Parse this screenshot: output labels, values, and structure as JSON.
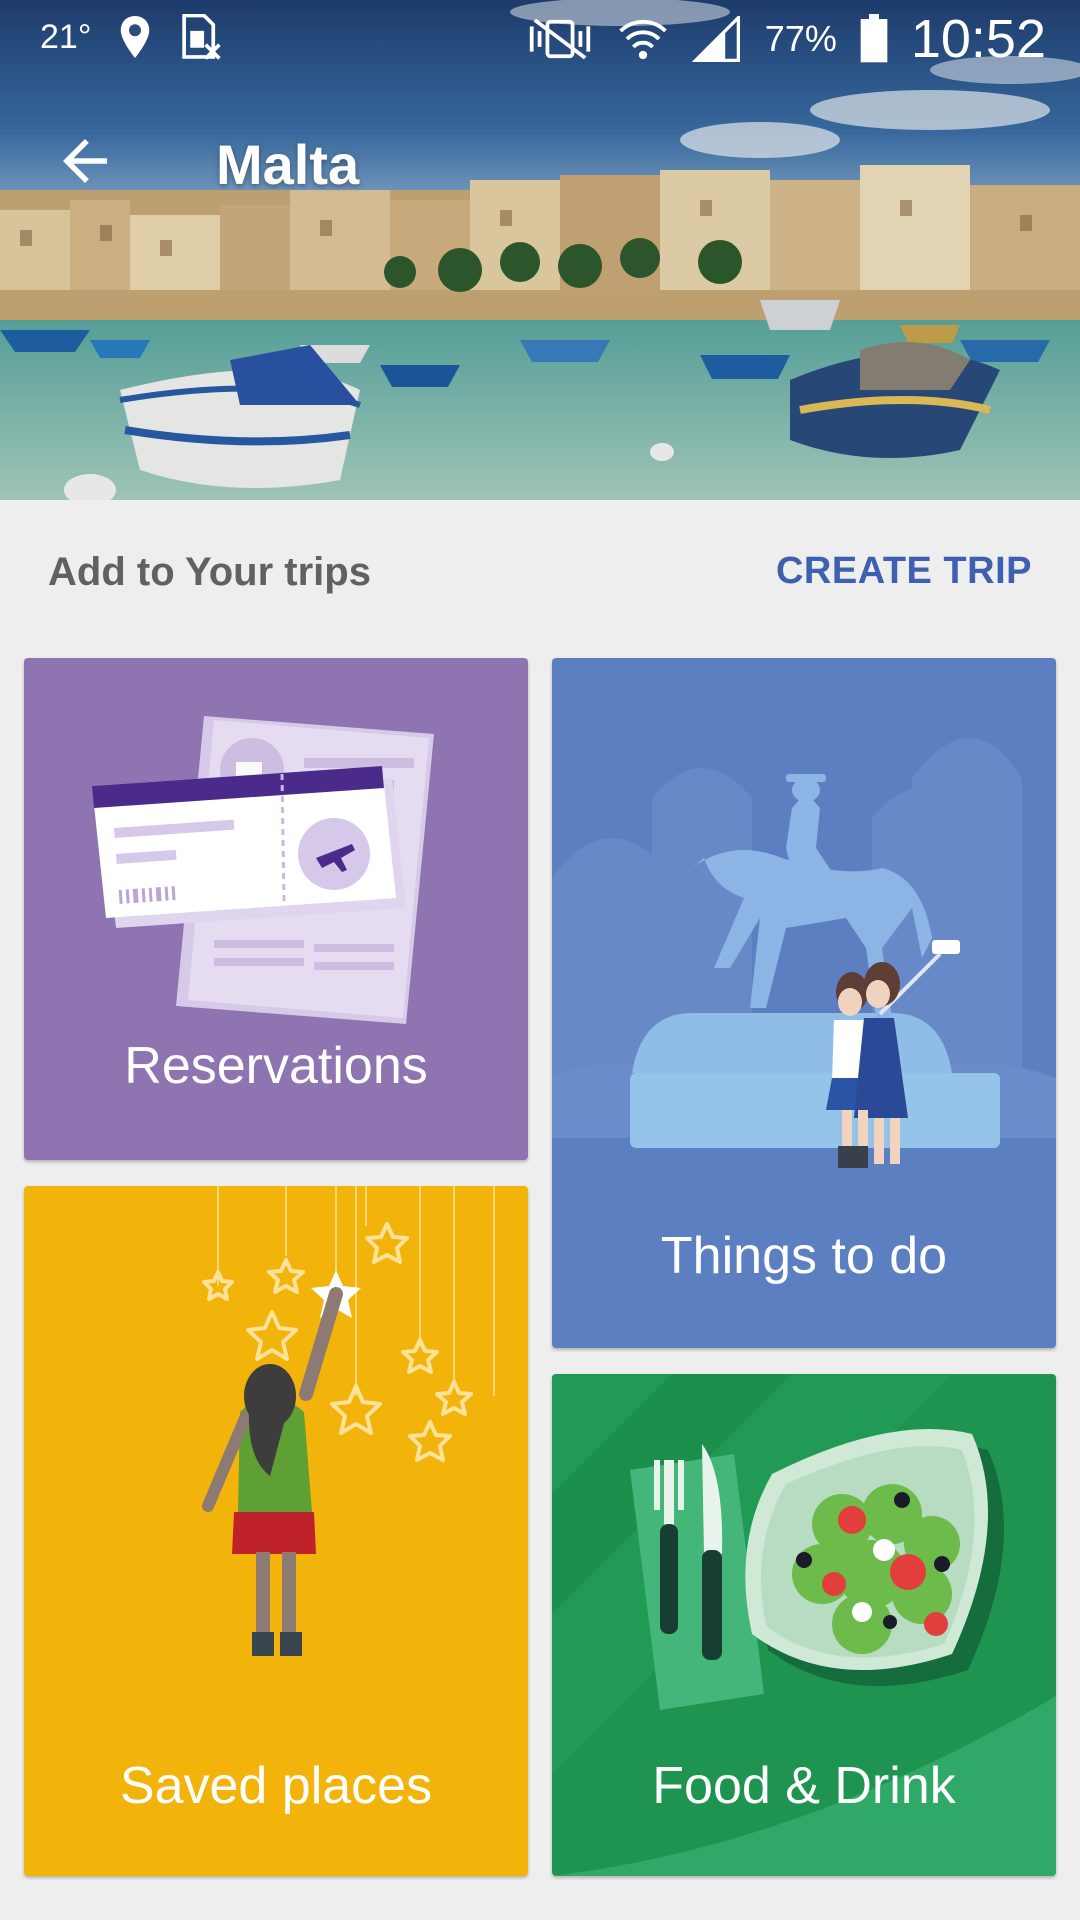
{
  "status_bar": {
    "temperature": "21°",
    "battery": "77%",
    "time": "10:52",
    "icons": [
      "location-icon",
      "sim-icon",
      "vibrate-icon",
      "wifi-icon",
      "signal-icon",
      "battery-icon"
    ]
  },
  "header": {
    "title": "Malta",
    "back_icon": "arrow-left-icon"
  },
  "trips": {
    "label": "Add to Your trips",
    "create_label": "CREATE TRIP"
  },
  "cards": {
    "reservations": {
      "label": "Reservations",
      "color": "#8e74b0"
    },
    "things_to_do": {
      "label": "Things to do",
      "color": "#5b7fc1"
    },
    "saved_places": {
      "label": "Saved places",
      "color": "#f2b40a"
    },
    "food_drink": {
      "label": "Food & Drink",
      "color": "#1e9450"
    }
  },
  "colors": {
    "accent": "#3f5fb0",
    "background": "#eeeeee"
  }
}
